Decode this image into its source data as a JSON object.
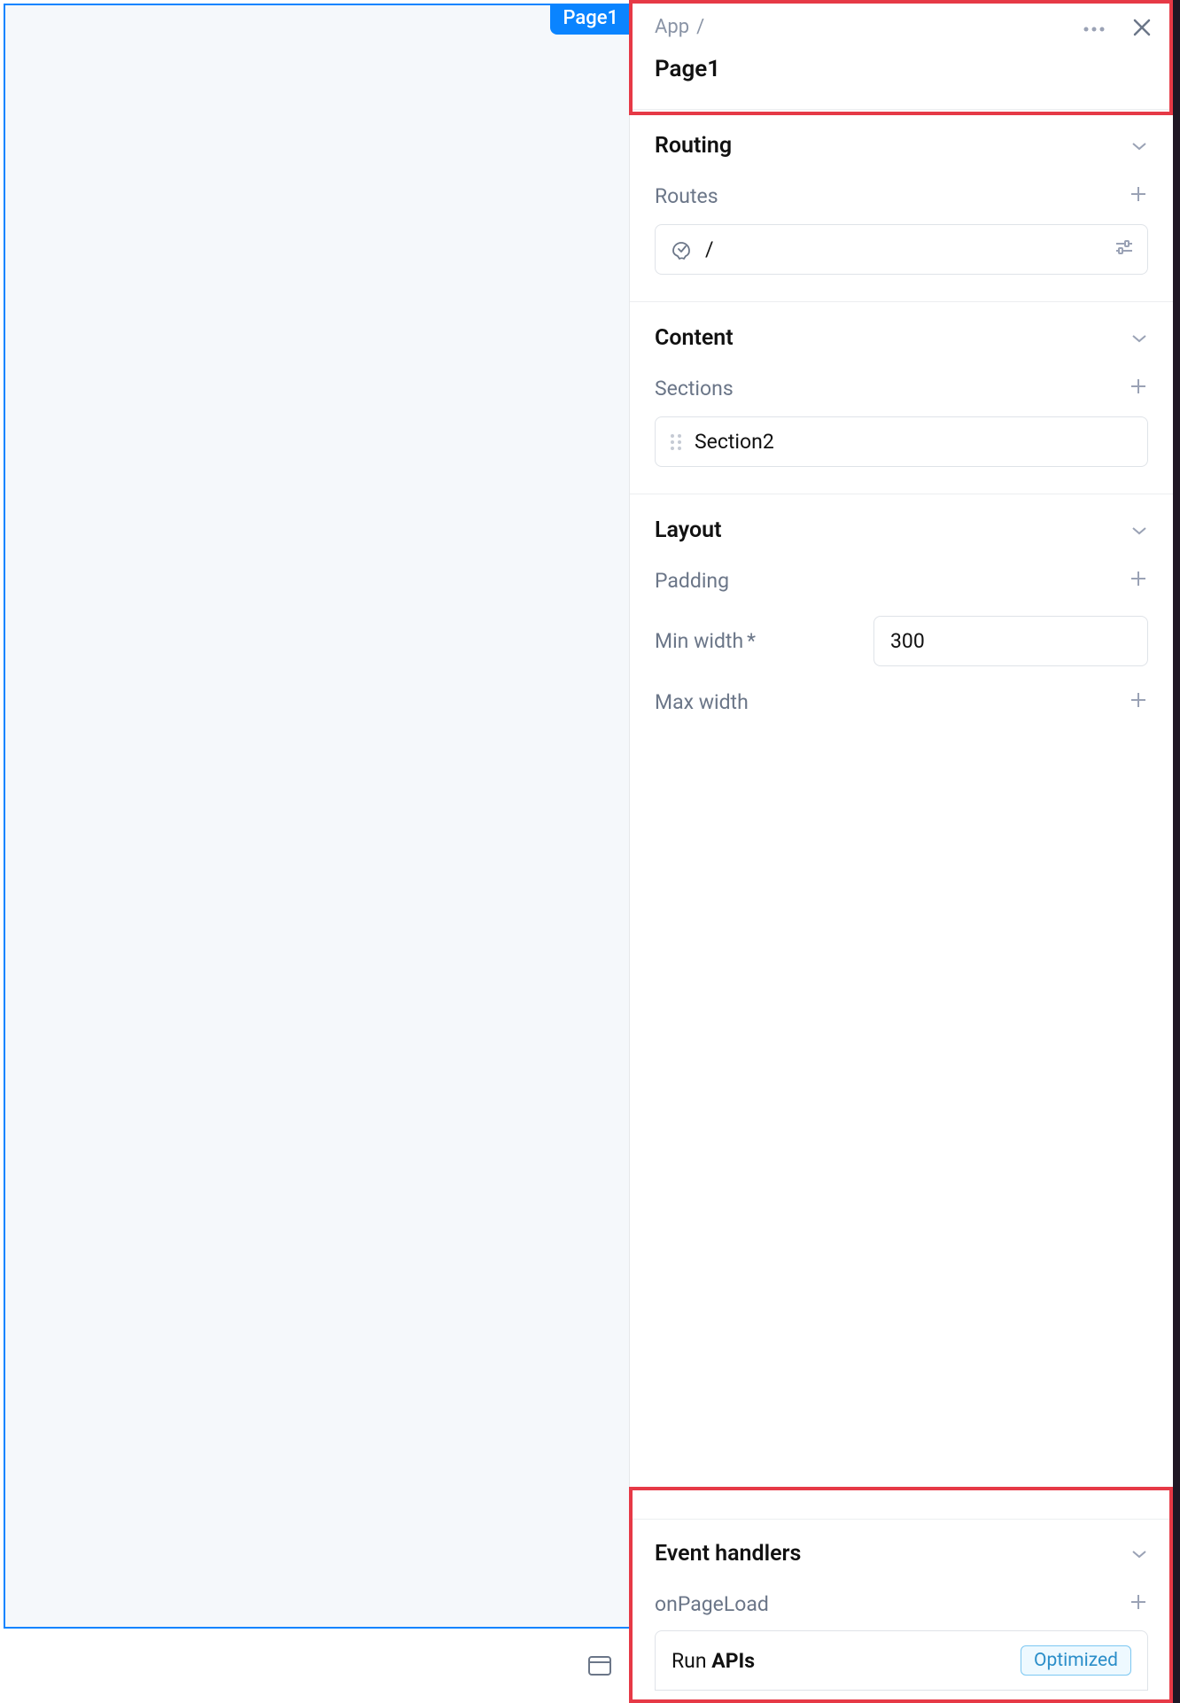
{
  "canvas": {
    "badge": "Page1"
  },
  "header": {
    "breadcrumb_root": "App",
    "breadcrumb_sep": "/",
    "title": "Page1"
  },
  "routing": {
    "title": "Routing",
    "routes_label": "Routes",
    "route_value": "/"
  },
  "content": {
    "title": "Content",
    "sections_label": "Sections",
    "section_name": "Section2"
  },
  "layout": {
    "title": "Layout",
    "padding_label": "Padding",
    "minwidth_label": "Min width",
    "minwidth_req": "*",
    "minwidth_value": "300",
    "maxwidth_label": "Max width"
  },
  "events": {
    "title": "Event handlers",
    "onload_label": "onPageLoad",
    "run_prefix": "Run ",
    "run_bold": "APIs",
    "badge": "Optimized"
  }
}
